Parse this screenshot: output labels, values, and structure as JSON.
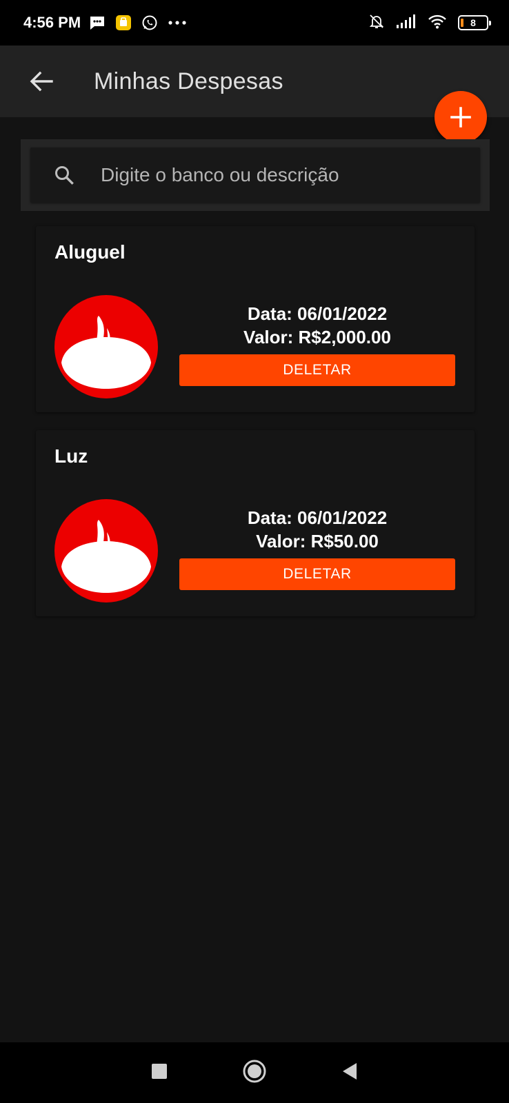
{
  "status_bar": {
    "time": "4:56 PM",
    "battery": "8",
    "icons": [
      "message-icon",
      "notification-app-icon",
      "whatsapp-icon",
      "more-dots-icon",
      "bell-off-icon",
      "signal-icon",
      "wifi-icon",
      "battery-icon"
    ]
  },
  "app_bar": {
    "title": "Minhas Despesas",
    "back_icon": "arrow-left-icon",
    "add_icon": "plus-icon"
  },
  "search": {
    "placeholder": "Digite o banco ou descrição",
    "value": ""
  },
  "expenses": [
    {
      "title": "Aluguel",
      "date_label": "Data: 06/01/2022",
      "value_label": "Valor: R$2,000.00",
      "bank_logo": "santander-logo-icon",
      "delete_label": "DELETAR"
    },
    {
      "title": "Luz",
      "date_label": "Data: 06/01/2022",
      "value_label": "Valor: R$50.00",
      "bank_logo": "santander-logo-icon",
      "delete_label": "DELETAR"
    }
  ],
  "colors": {
    "accent": "#ff4500",
    "background": "#131313",
    "appbar": "#222222",
    "logo_red": "#ec0000"
  },
  "nav_bar": {
    "icons": [
      "recents-square-icon",
      "home-circle-icon",
      "back-triangle-icon"
    ]
  }
}
